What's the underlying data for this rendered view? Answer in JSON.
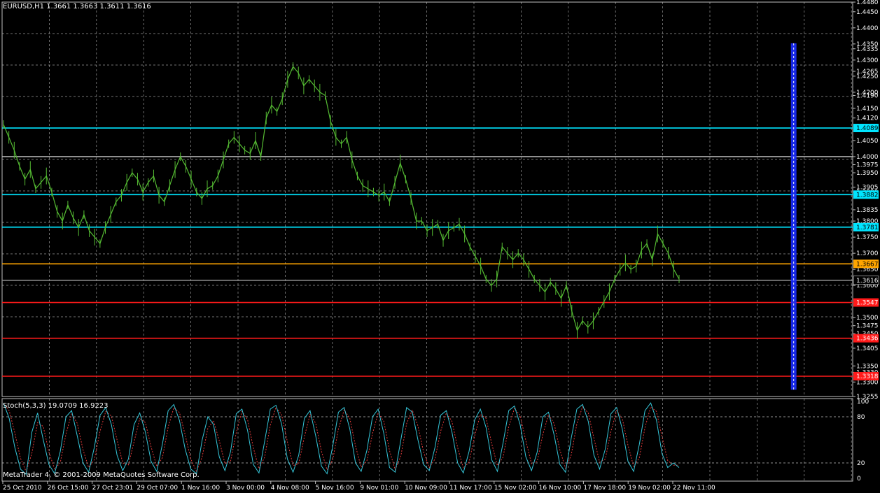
{
  "symbol_info": "EURUSD,H1  1.3661 1.3663 1.3611 1.3616",
  "stoch_info": "Stoch(5,3,3) 19.0709 16.9223",
  "copyright": "MetaTrader 4, © 2001-2009 MetaQuotes Software Corp.",
  "colors": {
    "background": "#000000",
    "grid": "#c0c0c0",
    "price_line": "#55bb33",
    "support_resistance": "#00e5ff",
    "pivot": "#c0c0c0",
    "current_marker": "#ffa500",
    "red_level": "#ff1a1a",
    "highlight_band": "#1a2cff",
    "stoch_main": "#35c6d9",
    "stoch_signal": "#e03a3a"
  },
  "price_axis": {
    "range": [
      1.3255,
      1.448
    ],
    "labels": [
      "1.4480",
      "1.4450",
      "1.4400",
      "1.4350",
      "1.4335",
      "1.4300",
      "1.4265",
      "1.4250",
      "1.4200",
      "1.4190",
      "1.4150",
      "1.4120",
      "1.4050",
      "1.4000",
      "1.3975",
      "1.3950",
      "1.3905",
      "1.3890",
      "1.3835",
      "1.3800",
      "1.3750",
      "1.3700",
      "1.3650",
      "1.3600",
      "1.3500",
      "1.3475",
      "1.3450",
      "1.3405",
      "1.3350",
      "1.3330",
      "1.3300",
      "1.3255"
    ],
    "badges": [
      {
        "text": "1.4089",
        "level": 1.4089,
        "bg": "#00e5ff",
        "fg": "#000000"
      },
      {
        "text": "1.3882",
        "level": 1.3882,
        "bg": "#00e5ff",
        "fg": "#000000"
      },
      {
        "text": "1.3781",
        "level": 1.3781,
        "bg": "#00e5ff",
        "fg": "#000000"
      },
      {
        "text": "1.3667",
        "level": 1.3667,
        "bg": "#ffa500",
        "fg": "#000000"
      },
      {
        "text": "1.3616",
        "level": 1.3616,
        "bg": "#000000",
        "fg": "#ffffff"
      },
      {
        "text": "1.3547",
        "level": 1.3547,
        "bg": "#ff1a1a",
        "fg": "#ffffff"
      },
      {
        "text": "1.3436",
        "level": 1.3436,
        "bg": "#ff1a1a",
        "fg": "#ffffff"
      },
      {
        "text": "1.3318",
        "level": 1.3318,
        "bg": "#ff1a1a",
        "fg": "#ffffff"
      }
    ]
  },
  "levels": [
    {
      "price": 1.4089,
      "color": "#00e5ff"
    },
    {
      "price": 1.4,
      "color": "#c0c0c0"
    },
    {
      "price": 1.3882,
      "color": "#00e5ff"
    },
    {
      "price": 1.3781,
      "color": "#00e5ff"
    },
    {
      "price": 1.3667,
      "color": "#ffa500"
    },
    {
      "price": 1.3616,
      "color": "#888888"
    },
    {
      "price": 1.3547,
      "color": "#ff1a1a"
    },
    {
      "price": 1.3436,
      "color": "#ff1a1a"
    },
    {
      "price": 1.3318,
      "color": "#ff1a1a"
    }
  ],
  "highlight_band_time_index": 0.966,
  "price_series": [
    1.41,
    1.406,
    1.402,
    1.397,
    1.393,
    1.396,
    1.39,
    1.392,
    1.394,
    1.389,
    1.383,
    1.38,
    1.385,
    1.381,
    1.378,
    1.382,
    1.377,
    1.375,
    1.373,
    1.378,
    1.382,
    1.386,
    1.388,
    1.392,
    1.395,
    1.393,
    1.389,
    1.392,
    1.394,
    1.388,
    1.386,
    1.391,
    1.396,
    1.4,
    1.397,
    1.393,
    1.389,
    1.387,
    1.39,
    1.391,
    1.394,
    1.399,
    1.404,
    1.406,
    1.404,
    1.402,
    1.401,
    1.405,
    1.4,
    1.412,
    1.416,
    1.414,
    1.418,
    1.424,
    1.428,
    1.426,
    1.422,
    1.424,
    1.422,
    1.42,
    1.419,
    1.411,
    1.406,
    1.404,
    1.406,
    1.399,
    1.394,
    1.391,
    1.39,
    1.389,
    1.388,
    1.389,
    1.386,
    1.392,
    1.398,
    1.393,
    1.387,
    1.38,
    1.38,
    1.377,
    1.378,
    1.379,
    1.374,
    1.377,
    1.378,
    1.379,
    1.376,
    1.372,
    1.369,
    1.366,
    1.362,
    1.36,
    1.362,
    1.372,
    1.37,
    1.368,
    1.37,
    1.368,
    1.365,
    1.362,
    1.36,
    1.358,
    1.361,
    1.359,
    1.356,
    1.36,
    1.352,
    1.346,
    1.349,
    1.347,
    1.349,
    1.352,
    1.355,
    1.358,
    1.362,
    1.365,
    1.367,
    1.365,
    1.366,
    1.371,
    1.373,
    1.368,
    1.376,
    1.373,
    1.37,
    1.365,
    1.362
  ],
  "price_series_min_max": [
    1.345,
    1.429
  ],
  "stoch_axis": {
    "labels": [
      "100",
      "80",
      "20",
      "0"
    ]
  },
  "stoch_series": [
    98,
    78,
    40,
    12,
    5,
    60,
    85,
    50,
    18,
    6,
    35,
    80,
    88,
    55,
    20,
    8,
    40,
    82,
    92,
    70,
    30,
    10,
    25,
    70,
    85,
    60,
    22,
    9,
    45,
    88,
    96,
    75,
    38,
    12,
    6,
    50,
    80,
    70,
    28,
    10,
    35,
    84,
    90,
    62,
    18,
    7,
    48,
    90,
    95,
    70,
    25,
    8,
    30,
    78,
    88,
    55,
    16,
    6,
    42,
    86,
    92,
    64,
    20,
    9,
    36,
    80,
    90,
    58,
    14,
    8,
    50,
    92,
    86,
    50,
    18,
    10,
    40,
    82,
    88,
    60,
    20,
    7,
    35,
    76,
    90,
    66,
    24,
    9,
    46,
    88,
    94,
    70,
    28,
    10,
    34,
    80,
    86,
    56,
    18,
    8,
    52,
    90,
    96,
    74,
    30,
    12,
    38,
    84,
    92,
    64,
    22,
    9,
    44,
    88,
    98,
    76,
    32,
    14,
    20,
    14
  ],
  "time_axis": [
    "25 Oct 2010",
    "26 Oct 15:00",
    "27 Oct 23:01",
    "29 Oct 07:00",
    "1 Nov 16:00",
    "3 Nov 00:00",
    "4 Nov 08:00",
    "5 Nov 16:00",
    "9 Nov 01:00",
    "10 Nov 09:00",
    "11 Nov 17:00",
    "15 Nov 02:00",
    "16 Nov 10:00",
    "17 Nov 18:00",
    "19 Nov 02:00",
    "22 Nov 11:00"
  ]
}
